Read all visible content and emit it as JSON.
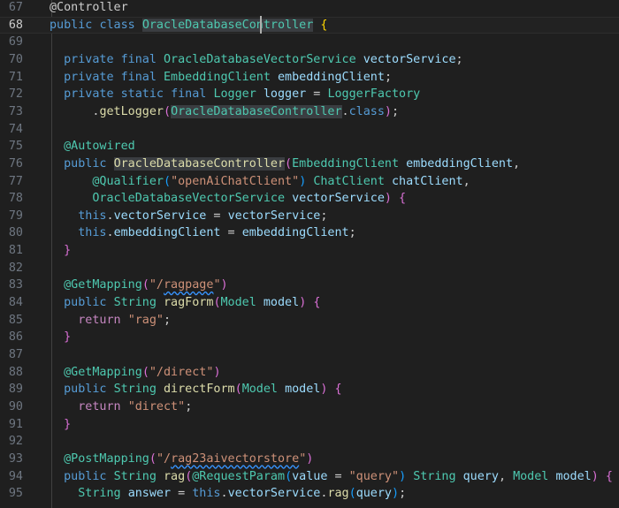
{
  "theme": {
    "background": "#1f1f1f",
    "current_line_background": "#222222",
    "line_number_color": "#6e7681",
    "active_line_number_color": "#cccccc",
    "keyword": "#569cd6",
    "control_keyword": "#c586c0",
    "type": "#4ec9b0",
    "function": "#dcdcaa",
    "variable": "#9cdcfe",
    "string": "#ce9178",
    "bracket_level1": "#ffd700",
    "bracket_level2": "#da70d6",
    "bracket_level3": "#179fff"
  },
  "editor": {
    "current_line": "68",
    "lines": [
      {
        "no": "67",
        "tokens": [
          [
            "pn",
            "@Controller"
          ]
        ]
      },
      {
        "no": "68",
        "tokens": [
          [
            "kw",
            "public"
          ],
          [
            "pn",
            " "
          ],
          [
            "kw",
            "class"
          ],
          [
            "pn",
            " "
          ],
          [
            "ty hl",
            "OracleDatabaseController"
          ],
          [
            "pn",
            " "
          ],
          [
            "br1",
            "{"
          ]
        ]
      },
      {
        "no": "69",
        "tokens": []
      },
      {
        "no": "70",
        "tokens": [
          [
            "pn",
            "  "
          ],
          [
            "kw",
            "private"
          ],
          [
            "pn",
            " "
          ],
          [
            "kw",
            "final"
          ],
          [
            "pn",
            " "
          ],
          [
            "ty",
            "OracleDatabaseVectorService"
          ],
          [
            "pn",
            " "
          ],
          [
            "var",
            "vectorService"
          ],
          [
            "pn",
            ";"
          ]
        ]
      },
      {
        "no": "71",
        "tokens": [
          [
            "pn",
            "  "
          ],
          [
            "kw",
            "private"
          ],
          [
            "pn",
            " "
          ],
          [
            "kw",
            "final"
          ],
          [
            "pn",
            " "
          ],
          [
            "ty",
            "EmbeddingClient"
          ],
          [
            "pn",
            " "
          ],
          [
            "var",
            "embeddingClient"
          ],
          [
            "pn",
            ";"
          ]
        ]
      },
      {
        "no": "72",
        "tokens": [
          [
            "pn",
            "  "
          ],
          [
            "kw",
            "private"
          ],
          [
            "pn",
            " "
          ],
          [
            "kw",
            "static"
          ],
          [
            "pn",
            " "
          ],
          [
            "kw",
            "final"
          ],
          [
            "pn",
            " "
          ],
          [
            "ty",
            "Logger"
          ],
          [
            "pn",
            " "
          ],
          [
            "var",
            "logger"
          ],
          [
            "pn",
            " = "
          ],
          [
            "ty",
            "LoggerFactory"
          ]
        ]
      },
      {
        "no": "73",
        "tokens": [
          [
            "pn",
            "      ."
          ],
          [
            "fn",
            "getLogger"
          ],
          [
            "br2",
            "("
          ],
          [
            "ty hl",
            "OracleDatabaseController"
          ],
          [
            "pn",
            "."
          ],
          [
            "kw",
            "class"
          ],
          [
            "br2",
            ")"
          ],
          [
            "pn",
            ";"
          ]
        ]
      },
      {
        "no": "74",
        "tokens": []
      },
      {
        "no": "75",
        "tokens": [
          [
            "pn",
            "  "
          ],
          [
            "ty",
            "@Autowired"
          ]
        ]
      },
      {
        "no": "76",
        "tokens": [
          [
            "pn",
            "  "
          ],
          [
            "kw",
            "public"
          ],
          [
            "pn",
            " "
          ],
          [
            "fn hl",
            "OracleDatabaseController"
          ],
          [
            "br2",
            "("
          ],
          [
            "ty",
            "EmbeddingClient"
          ],
          [
            "pn",
            " "
          ],
          [
            "var",
            "embeddingClient"
          ],
          [
            "pn",
            ","
          ]
        ]
      },
      {
        "no": "77",
        "tokens": [
          [
            "pn",
            "      "
          ],
          [
            "ty",
            "@Qualifier"
          ],
          [
            "br3",
            "("
          ],
          [
            "str",
            "\"openAiChatClient\""
          ],
          [
            "br3",
            ")"
          ],
          [
            "pn",
            " "
          ],
          [
            "ty",
            "ChatClient"
          ],
          [
            "pn",
            " "
          ],
          [
            "var",
            "chatClient"
          ],
          [
            "pn",
            ","
          ]
        ]
      },
      {
        "no": "78",
        "tokens": [
          [
            "pn",
            "      "
          ],
          [
            "ty",
            "OracleDatabaseVectorService"
          ],
          [
            "pn",
            " "
          ],
          [
            "var",
            "vectorService"
          ],
          [
            "br2",
            ")"
          ],
          [
            "pn",
            " "
          ],
          [
            "br2",
            "{"
          ]
        ]
      },
      {
        "no": "79",
        "tokens": [
          [
            "pn",
            "    "
          ],
          [
            "kw",
            "this"
          ],
          [
            "pn",
            "."
          ],
          [
            "var",
            "vectorService"
          ],
          [
            "pn",
            " = "
          ],
          [
            "var",
            "vectorService"
          ],
          [
            "pn",
            ";"
          ]
        ]
      },
      {
        "no": "80",
        "tokens": [
          [
            "pn",
            "    "
          ],
          [
            "kw",
            "this"
          ],
          [
            "pn",
            "."
          ],
          [
            "var",
            "embeddingClient"
          ],
          [
            "pn",
            " = "
          ],
          [
            "var",
            "embeddingClient"
          ],
          [
            "pn",
            ";"
          ]
        ]
      },
      {
        "no": "81",
        "tokens": [
          [
            "pn",
            "  "
          ],
          [
            "br2",
            "}"
          ]
        ]
      },
      {
        "no": "82",
        "tokens": []
      },
      {
        "no": "83",
        "tokens": [
          [
            "pn",
            "  "
          ],
          [
            "ty",
            "@GetMapping"
          ],
          [
            "br2",
            "("
          ],
          [
            "str",
            "\"/"
          ],
          [
            "str sq",
            "ragpage"
          ],
          [
            "str",
            "\""
          ],
          [
            "br2",
            ")"
          ]
        ]
      },
      {
        "no": "84",
        "tokens": [
          [
            "pn",
            "  "
          ],
          [
            "kw",
            "public"
          ],
          [
            "pn",
            " "
          ],
          [
            "ty",
            "String"
          ],
          [
            "pn",
            " "
          ],
          [
            "fn",
            "ragForm"
          ],
          [
            "br2",
            "("
          ],
          [
            "ty",
            "Model"
          ],
          [
            "pn",
            " "
          ],
          [
            "var",
            "model"
          ],
          [
            "br2",
            ")"
          ],
          [
            "pn",
            " "
          ],
          [
            "br2",
            "{"
          ]
        ]
      },
      {
        "no": "85",
        "tokens": [
          [
            "pn",
            "    "
          ],
          [
            "ctl",
            "return"
          ],
          [
            "pn",
            " "
          ],
          [
            "str",
            "\"rag\""
          ],
          [
            "pn",
            ";"
          ]
        ]
      },
      {
        "no": "86",
        "tokens": [
          [
            "pn",
            "  "
          ],
          [
            "br2",
            "}"
          ]
        ]
      },
      {
        "no": "87",
        "tokens": []
      },
      {
        "no": "88",
        "tokens": [
          [
            "pn",
            "  "
          ],
          [
            "ty",
            "@GetMapping"
          ],
          [
            "br2",
            "("
          ],
          [
            "str",
            "\"/direct\""
          ],
          [
            "br2",
            ")"
          ]
        ]
      },
      {
        "no": "89",
        "tokens": [
          [
            "pn",
            "  "
          ],
          [
            "kw",
            "public"
          ],
          [
            "pn",
            " "
          ],
          [
            "ty",
            "String"
          ],
          [
            "pn",
            " "
          ],
          [
            "fn",
            "directForm"
          ],
          [
            "br2",
            "("
          ],
          [
            "ty",
            "Model"
          ],
          [
            "pn",
            " "
          ],
          [
            "var",
            "model"
          ],
          [
            "br2",
            ")"
          ],
          [
            "pn",
            " "
          ],
          [
            "br2",
            "{"
          ]
        ]
      },
      {
        "no": "90",
        "tokens": [
          [
            "pn",
            "    "
          ],
          [
            "ctl",
            "return"
          ],
          [
            "pn",
            " "
          ],
          [
            "str",
            "\"direct\""
          ],
          [
            "pn",
            ";"
          ]
        ]
      },
      {
        "no": "91",
        "tokens": [
          [
            "pn",
            "  "
          ],
          [
            "br2",
            "}"
          ]
        ]
      },
      {
        "no": "92",
        "tokens": []
      },
      {
        "no": "93",
        "tokens": [
          [
            "pn",
            "  "
          ],
          [
            "ty",
            "@PostMapping"
          ],
          [
            "br2",
            "("
          ],
          [
            "str",
            "\"/"
          ],
          [
            "str sq",
            "rag23aivectorstore"
          ],
          [
            "str",
            "\""
          ],
          [
            "br2",
            ")"
          ]
        ]
      },
      {
        "no": "94",
        "tokens": [
          [
            "pn",
            "  "
          ],
          [
            "kw",
            "public"
          ],
          [
            "pn",
            " "
          ],
          [
            "ty",
            "String"
          ],
          [
            "pn",
            " "
          ],
          [
            "fn",
            "rag"
          ],
          [
            "br2",
            "("
          ],
          [
            "ty",
            "@RequestParam"
          ],
          [
            "br3",
            "("
          ],
          [
            "var",
            "value"
          ],
          [
            "pn",
            " = "
          ],
          [
            "str",
            "\"query\""
          ],
          [
            "br3",
            ")"
          ],
          [
            "pn",
            " "
          ],
          [
            "ty",
            "String"
          ],
          [
            "pn",
            " "
          ],
          [
            "var",
            "query"
          ],
          [
            "pn",
            ", "
          ],
          [
            "ty",
            "Model"
          ],
          [
            "pn",
            " "
          ],
          [
            "var",
            "model"
          ],
          [
            "br2",
            ")"
          ],
          [
            "pn",
            " "
          ],
          [
            "br2",
            "{"
          ]
        ]
      },
      {
        "no": "95",
        "tokens": [
          [
            "pn",
            "    "
          ],
          [
            "ty",
            "String"
          ],
          [
            "pn",
            " "
          ],
          [
            "var",
            "answer"
          ],
          [
            "pn",
            " = "
          ],
          [
            "kw",
            "this"
          ],
          [
            "pn",
            "."
          ],
          [
            "var",
            "vectorService"
          ],
          [
            "pn",
            "."
          ],
          [
            "fn",
            "rag"
          ],
          [
            "br3",
            "("
          ],
          [
            "var",
            "query"
          ],
          [
            "br3",
            ")"
          ],
          [
            "pn",
            ";"
          ]
        ]
      }
    ]
  }
}
